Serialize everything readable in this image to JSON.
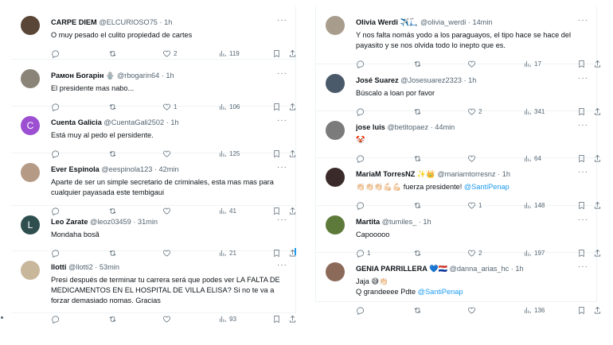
{
  "left": [
    {
      "name": "CARPE DIEM",
      "handle": "@ELCURIOSO75",
      "time": "1h",
      "text": "O muy pesado el culito propiedad de cartes",
      "replies": "",
      "retweets": "",
      "likes": "2",
      "views": "119",
      "avatar_color": "#5a4636"
    },
    {
      "name": "Рамон Богарін 🪬",
      "handle": "@rbogarin64",
      "time": "1h",
      "text": "El presidente mas nabo...",
      "replies": "",
      "retweets": "",
      "likes": "1",
      "views": "106",
      "avatar_color": "#8a8478"
    },
    {
      "name": "Cuenta Galicia",
      "handle": "@CuentaGali2502",
      "time": "1h",
      "text": "Está muy al pedo el persidente.",
      "replies": "",
      "retweets": "",
      "likes": "",
      "views": "125",
      "avatar_color": "#9c4fd1",
      "avatar_letter": "C"
    },
    {
      "name": "Ever Espinola",
      "handle": "@eespinola123",
      "time": "42min",
      "text": "Aparte de ser un simple secretario de criminales, esta mas mas para cualquier payasada este tembigaui",
      "replies": "",
      "retweets": "",
      "likes": "",
      "views": "41",
      "avatar_color": "#b59a86"
    },
    {
      "name": "Leo Zarate",
      "handle": "@leoz03459",
      "time": "31min",
      "text": "Mondaha bosã",
      "replies": "",
      "retweets": "",
      "likes": "",
      "views": "21",
      "avatar_color": "#2f4f4f",
      "avatar_letter": "L"
    },
    {
      "name": "llotti",
      "handle": "@llotti2",
      "time": "53min",
      "text": "Presi después de terminar tu carrera será que podes ver LA FALTA DE MEDICAMENTOS EN EL HOSPITAL DE VILLA ELISA? Si no te va a forzar demasiado nomas. Gracias",
      "replies": "",
      "retweets": "",
      "likes": "",
      "views": "93",
      "avatar_color": "#c9b79c"
    }
  ],
  "right": [
    {
      "name": "Olivia Werdi ✈️🛴",
      "handle": "@olivia_werdi",
      "time": "14min",
      "text": "Y nos falta nomás yodo a los paraguayos, el tipo hace se hace del payasito y se nos olvida todo lo inepto que es.",
      "replies": "",
      "retweets": "",
      "likes": "",
      "views": "17",
      "avatar_color": "#a89c8c"
    },
    {
      "name": "José Suarez",
      "handle": "@Josesuarez2323",
      "time": "1h",
      "text": "Búscalo a loan por favor",
      "replies": "",
      "retweets": "",
      "likes": "2",
      "views": "341",
      "avatar_color": "#4a5a6a"
    },
    {
      "name": "jose luis",
      "handle": "@betitopaez",
      "time": "44min",
      "text": "🤡",
      "replies": "",
      "retweets": "",
      "likes": "",
      "views": "64",
      "avatar_color": "#7b7b7b"
    },
    {
      "name": "MariaM TorresNZ ✨👑",
      "handle": "@mariamtorresnz",
      "time": "1h",
      "text_pre": "👏🏻👏🏻👏🏻💪🏻💪🏻 fuerza presidente! ",
      "mention": "@SantiPenap",
      "replies": "",
      "retweets": "",
      "likes": "1",
      "views": "148",
      "avatar_color": "#3b2a2a"
    },
    {
      "name": "Martita",
      "handle": "@tumiles_",
      "time": "1h",
      "text": "Capooooo",
      "replies": "1",
      "retweets": "",
      "likes": "2",
      "views": "197",
      "avatar_color": "#5d7a3a"
    },
    {
      "name": "GENIA PARRILLERA 💙🇵🇾",
      "handle": "@danna_arias_hc",
      "time": "1h",
      "text": "Jaja 😅👏🏻",
      "text2_pre": "Q grandeeee Pdte ",
      "mention": "@SantiPenap",
      "replies": "",
      "retweets": "",
      "likes": "",
      "views": "136",
      "avatar_color": "#8c6a5a"
    }
  ],
  "more_glyph": "···",
  "sep": "·"
}
